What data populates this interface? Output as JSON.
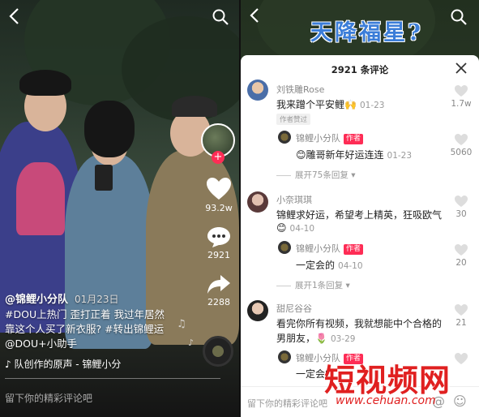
{
  "video": {
    "author": "@锦鲤小分队",
    "date": "01月23日",
    "caption_lines": [
      "#DOU上热门 歪打正着 我过年居然",
      "靠这个人买了新衣服? #转出锦鲤运",
      "@DOU+小助手"
    ],
    "music": "♪ 队创作的原声 - 锦鲤小分",
    "likes": "93.2w",
    "comments": "2921",
    "shares": "2288",
    "comment_placeholder": "留下你的精彩评论吧"
  },
  "right": {
    "banner": "天降福星?",
    "sheet_title": "2921 条评论",
    "comments": [
      {
        "name": "刘铁雕Rose",
        "text": "我来蹭个平安鲤",
        "emoji": "🙌",
        "date": "01-23",
        "badge": "作者赞过",
        "likes": "1.7w"
      },
      {
        "name": "锦鲤小分队",
        "badge": "作者",
        "text": "雕哥新年好运连连",
        "emoji": "😊",
        "date": "01-23",
        "likes": "5060",
        "expand": "展开75条回复"
      },
      {
        "name": "小奈琪琪",
        "text": "锦鲤求好运，希望考上精英，狂吸欧气",
        "emoji": "😊",
        "date": "04-10",
        "likes": "30"
      },
      {
        "name": "锦鲤小分队",
        "badge": "作者",
        "text": "一定会的",
        "date": "04-10",
        "likes": "20",
        "expand": "展开1条回复"
      },
      {
        "name": "甜尼谷谷",
        "text": "看完你所有视频，我就想能中个合格的",
        "text2": "男朋友，",
        "emoji": "🌷",
        "date": "03-29",
        "likes": "21"
      },
      {
        "name": "锦鲤小分队",
        "badge": "作者",
        "text": "一定会的"
      }
    ],
    "comment_placeholder": "留下你的精彩评论吧"
  },
  "watermark": {
    "title": "短视频网",
    "url": "www.cehuan.com"
  },
  "colors": {
    "accent": "#fe2c55",
    "banner": "#3b7dd8",
    "watermark": "#e02020"
  }
}
